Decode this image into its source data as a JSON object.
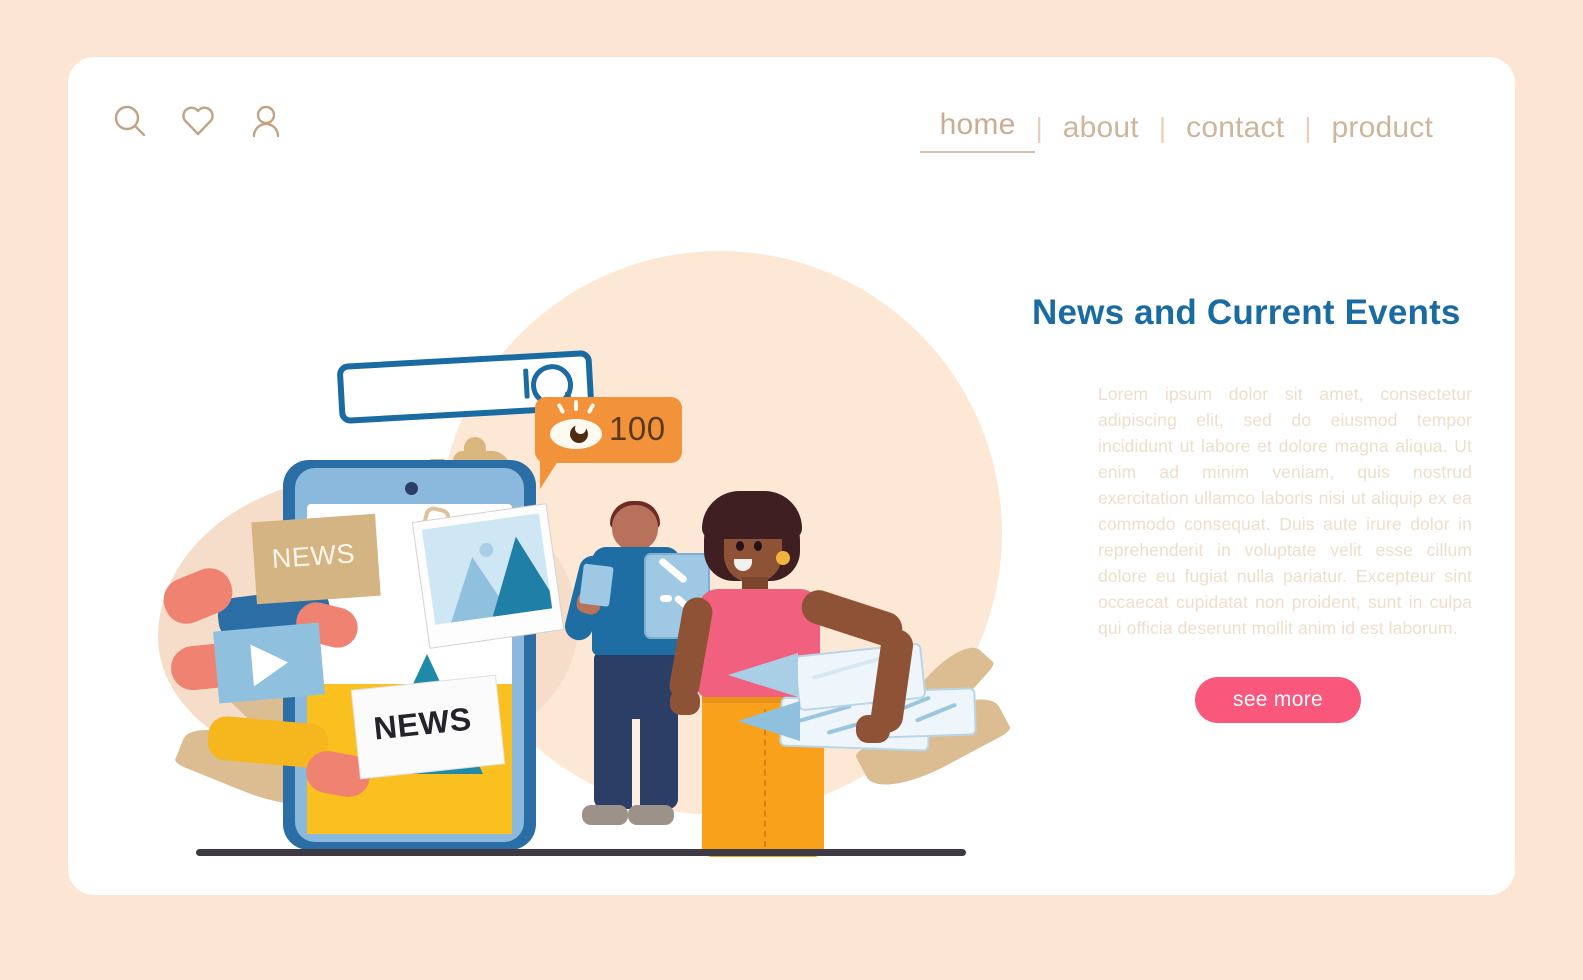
{
  "theme": {
    "page_bg": "#fce6d3",
    "card_bg": "#ffffff",
    "accent_blue": "#1b6ba3",
    "accent_pink": "#f9577c",
    "accent_orange": "#f2933c",
    "nav_text": "#cfb59b",
    "body_text": "#eddfcc",
    "tan": "#d4b483"
  },
  "header": {
    "icons": [
      {
        "name": "search-icon",
        "label": "search"
      },
      {
        "name": "heart-icon",
        "label": "favorites"
      },
      {
        "name": "user-icon",
        "label": "account"
      }
    ],
    "nav": [
      {
        "label": "home",
        "active": true
      },
      {
        "label": "about",
        "active": false
      },
      {
        "label": "contact",
        "active": false
      },
      {
        "label": "product",
        "active": false
      }
    ],
    "separator": "|"
  },
  "main": {
    "headline": "News and Current Events",
    "paragraph": "Lorem ipsum dolor sit amet, consectetur adipiscing elit, sed do eiusmod tempor incididunt ut labore et dolore magna aliqua. Ut enim ad minim veniam, quis nostrud exercitation ullamco laboris nisi ut aliquip ex ea commodo consequat. Duis aute irure dolor in reprehenderit in voluptate velit esse cillum dolore eu fugiat nulla pariatur. Excepteur sint occaecat cupidatat non proident, sunt in culpa qui officia deserunt mollit anim id est laborum.",
    "cta_label": "see more"
  },
  "illustration": {
    "view_badge": {
      "icon": "eye-icon",
      "count": "100"
    },
    "news_card_tan_label": "NEWS",
    "news_paper_label": "NEWS",
    "thumbs_up_icon": "thumbs-up-icon",
    "play_icon": "play-icon",
    "search_bar_icon": "magnifier-icon",
    "photo_icon": "image-icon",
    "megaphone_icon": "megaphone-icon",
    "characters": [
      {
        "name": "man-with-tablet"
      },
      {
        "name": "woman-with-newspapers"
      }
    ]
  }
}
